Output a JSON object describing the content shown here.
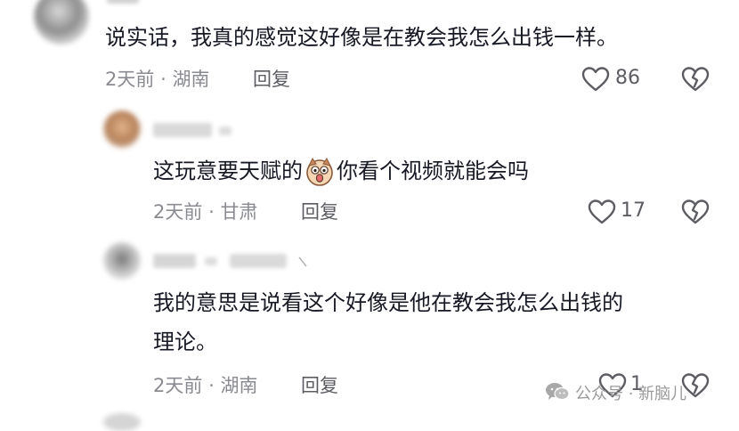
{
  "comments": [
    {
      "text": "说实话，我真的感觉这好像是在教会我怎么出钱一样。",
      "time": "2天前",
      "location": "湖南",
      "reply_label": "回复",
      "likes": "86"
    },
    {
      "text_before": "这玩意要天赋的",
      "text_after": "你看个视频就能会吗",
      "emoji": "shocked-dog-emoji",
      "time": "2天前",
      "location": "甘肃",
      "reply_label": "回复",
      "likes": "17"
    },
    {
      "text_line1": "我的意思是说看这个好像是他在教会我怎么出钱的",
      "text_line2": "理论。",
      "time": "2天前",
      "location": "湖南",
      "reply_label": "回复",
      "likes": "1"
    }
  ],
  "separator": "·",
  "watermark": "公众号 · 新脑儿",
  "colors": {
    "text": "#161823",
    "meta": "#8a8b91",
    "icon": "#5c5d63"
  }
}
